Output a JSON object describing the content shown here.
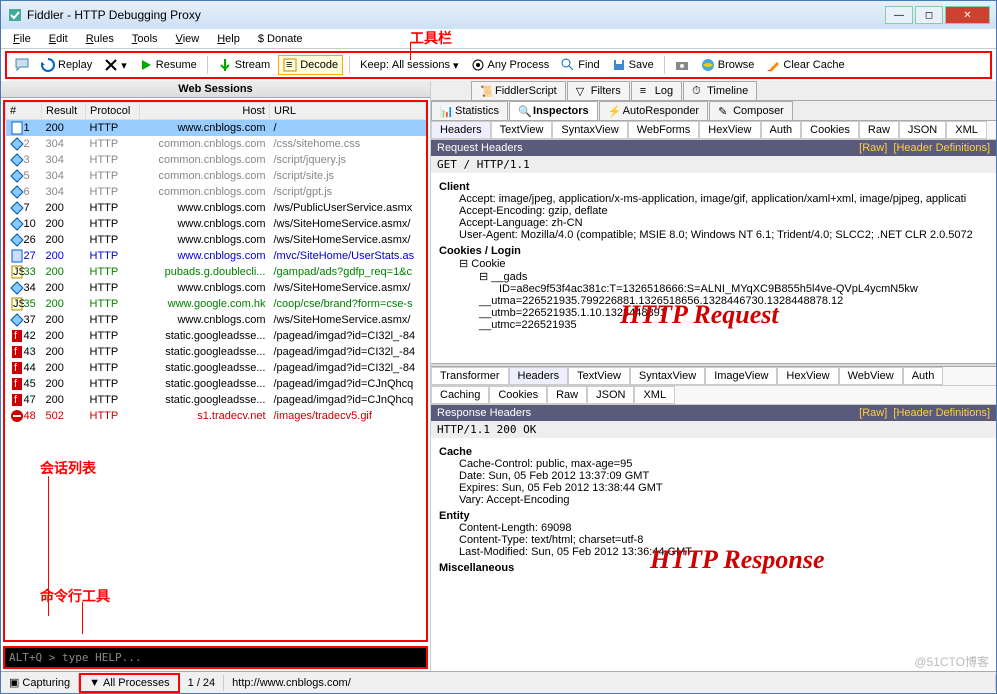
{
  "window": {
    "title": "Fiddler - HTTP Debugging Proxy"
  },
  "menu": {
    "file": "File",
    "edit": "Edit",
    "rules": "Rules",
    "tools": "Tools",
    "view": "View",
    "help": "Help",
    "donate": "$ Donate"
  },
  "toolbar": {
    "replay": "Replay",
    "resume": "Resume",
    "stream": "Stream",
    "decode": "Decode",
    "keep_label": "Keep:",
    "keep_value": "All sessions",
    "any_process": "Any Process",
    "find": "Find",
    "save": "Save",
    "browse": "Browse",
    "clear": "Clear Cache"
  },
  "annotations": {
    "toolbar_label": "工具栏",
    "sessions_label": "会话列表",
    "cmdline_label": "命令行工具",
    "request_label": "HTTP Request",
    "response_label": "HTTP Response"
  },
  "sessions_header": "Web Sessions",
  "columns": {
    "num": "#",
    "result": "Result",
    "protocol": "Protocol",
    "host": "Host",
    "url": "URL"
  },
  "sessions": [
    {
      "n": "1",
      "r": "200",
      "p": "HTTP",
      "h": "www.cnblogs.com",
      "u": "/",
      "cls": "sel",
      "ic": "doc"
    },
    {
      "n": "2",
      "r": "304",
      "p": "HTTP",
      "h": "common.cnblogs.com",
      "u": "/css/sitehome.css",
      "cls": "gray",
      "ic": "di"
    },
    {
      "n": "3",
      "r": "304",
      "p": "HTTP",
      "h": "common.cnblogs.com",
      "u": "/script/jquery.js",
      "cls": "gray",
      "ic": "di"
    },
    {
      "n": "5",
      "r": "304",
      "p": "HTTP",
      "h": "common.cnblogs.com",
      "u": "/script/site.js",
      "cls": "gray",
      "ic": "di"
    },
    {
      "n": "6",
      "r": "304",
      "p": "HTTP",
      "h": "common.cnblogs.com",
      "u": "/script/gpt.js",
      "cls": "gray",
      "ic": "di"
    },
    {
      "n": "7",
      "r": "200",
      "p": "HTTP",
      "h": "www.cnblogs.com",
      "u": "/ws/PublicUserService.asmx",
      "cls": "",
      "ic": "di"
    },
    {
      "n": "10",
      "r": "200",
      "p": "HTTP",
      "h": "www.cnblogs.com",
      "u": "/ws/SiteHomeService.asmx/",
      "cls": "",
      "ic": "di"
    },
    {
      "n": "26",
      "r": "200",
      "p": "HTTP",
      "h": "www.cnblogs.com",
      "u": "/ws/SiteHomeService.asmx/",
      "cls": "",
      "ic": "di"
    },
    {
      "n": "27",
      "r": "200",
      "p": "HTTP",
      "h": "www.cnblogs.com",
      "u": "/mvc/SiteHome/UserStats.as",
      "cls": "blue",
      "ic": "docb"
    },
    {
      "n": "33",
      "r": "200",
      "p": "HTTP",
      "h": "pubads.g.doublecli...",
      "u": "/gampad/ads?gdfp_req=1&c",
      "cls": "green",
      "ic": "js"
    },
    {
      "n": "34",
      "r": "200",
      "p": "HTTP",
      "h": "www.cnblogs.com",
      "u": "/ws/SiteHomeService.asmx/",
      "cls": "",
      "ic": "di"
    },
    {
      "n": "35",
      "r": "200",
      "p": "HTTP",
      "h": "www.google.com.hk",
      "u": "/coop/cse/brand?form=cse-s",
      "cls": "green",
      "ic": "js"
    },
    {
      "n": "37",
      "r": "200",
      "p": "HTTP",
      "h": "www.cnblogs.com",
      "u": "/ws/SiteHomeService.asmx/",
      "cls": "",
      "ic": "di"
    },
    {
      "n": "42",
      "r": "200",
      "p": "HTTP",
      "h": "static.googleadsse...",
      "u": "/pagead/imgad?id=CI32l_-84",
      "cls": "",
      "ic": "fl"
    },
    {
      "n": "43",
      "r": "200",
      "p": "HTTP",
      "h": "static.googleadsse...",
      "u": "/pagead/imgad?id=CI32l_-84",
      "cls": "",
      "ic": "fl"
    },
    {
      "n": "44",
      "r": "200",
      "p": "HTTP",
      "h": "static.googleadsse...",
      "u": "/pagead/imgad?id=CI32l_-84",
      "cls": "",
      "ic": "fl"
    },
    {
      "n": "45",
      "r": "200",
      "p": "HTTP",
      "h": "static.googleadsse...",
      "u": "/pagead/imgad?id=CJnQhcq",
      "cls": "",
      "ic": "fl"
    },
    {
      "n": "47",
      "r": "200",
      "p": "HTTP",
      "h": "static.googleadsse...",
      "u": "/pagead/imgad?id=CJnQhcq",
      "cls": "",
      "ic": "fl"
    },
    {
      "n": "48",
      "r": "502",
      "p": "HTTP",
      "h": "s1.tradecv.net",
      "u": "/images/tradecv5.gif",
      "cls": "red",
      "ic": "err"
    }
  ],
  "cmdline": "ALT+Q > type HELP...",
  "right_tabs_row1": {
    "fiddlerscript": "FiddlerScript",
    "filters": "Filters",
    "log": "Log",
    "timeline": "Timeline"
  },
  "right_tabs_row2": {
    "statistics": "Statistics",
    "inspectors": "Inspectors",
    "autoresponder": "AutoResponder",
    "composer": "Composer"
  },
  "req_tabs": {
    "headers": "Headers",
    "textview": "TextView",
    "syntaxview": "SyntaxView",
    "webforms": "WebForms",
    "hexview": "HexView",
    "auth": "Auth",
    "cookies": "Cookies",
    "raw": "Raw",
    "json": "JSON",
    "xml": "XML"
  },
  "req_header_bar": {
    "title": "Request Headers",
    "raw": "[Raw]",
    "defs": "[Header Definitions]"
  },
  "req_line": "GET / HTTP/1.1",
  "req": {
    "client": "Client",
    "accept": "Accept: image/jpeg, application/x-ms-application, image/gif, application/xaml+xml, image/pjpeg, applicati",
    "accept_enc": "Accept-Encoding: gzip, deflate",
    "accept_lang": "Accept-Language: zh-CN",
    "ua": "User-Agent: Mozilla/4.0 (compatible; MSIE 8.0; Windows NT 6.1; Trident/4.0; SLCC2; .NET CLR 2.0.5072",
    "cookies_login": "Cookies / Login",
    "cookie": "Cookie",
    "gads": "__gads",
    "gads_id": "ID=a8ec9f53f4ac381c:T=1326518666:S=ALNI_MYqXC9B855h5l4ve-QVpL4ycmN5kw",
    "utma": "__utma=226521935.799226881.1326518656.1328446730.1328448878.12",
    "utmb": "__utmb=226521935.1.10.1328448891",
    "utmc": "__utmc=226521935"
  },
  "resp_tabs": {
    "transformer": "Transformer",
    "headers": "Headers",
    "textview": "TextView",
    "syntaxview": "SyntaxView",
    "imageview": "ImageView",
    "hexview": "HexView",
    "webview": "WebView",
    "auth": "Auth",
    "caching": "Caching",
    "cookies": "Cookies",
    "raw": "Raw",
    "json": "JSON",
    "xml": "XML"
  },
  "resp_header_bar": {
    "title": "Response Headers",
    "raw": "[Raw]",
    "defs": "[Header Definitions]"
  },
  "resp_line": "HTTP/1.1 200 OK",
  "resp": {
    "cache": "Cache",
    "cache_ctrl": "Cache-Control: public, max-age=95",
    "date": "Date: Sun, 05 Feb 2012 13:37:09 GMT",
    "expires": "Expires: Sun, 05 Feb 2012 13:38:44 GMT",
    "vary": "Vary: Accept-Encoding",
    "entity": "Entity",
    "clen": "Content-Length: 69098",
    "ctype": "Content-Type: text/html; charset=utf-8",
    "lastmod": "Last-Modified: Sun, 05 Feb 2012 13:36:44 GMT",
    "misc": "Miscellaneous"
  },
  "status": {
    "capturing": "Capturing",
    "all_processes": "All Processes",
    "count": "1 / 24",
    "url": "http://www.cnblogs.com/"
  },
  "watermark": "@51CTO博客"
}
